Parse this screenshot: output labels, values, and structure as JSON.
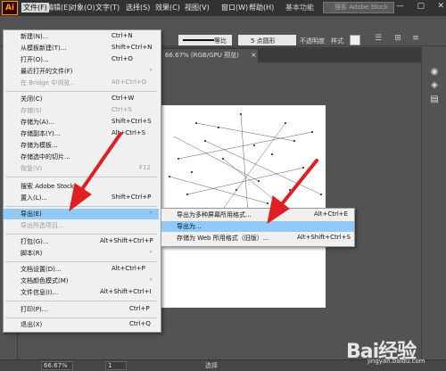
{
  "app": {
    "logo": "Ai",
    "workspace": "基本功能",
    "stock_search_placeholder": "搜索 Adobe Stock"
  },
  "menubar": [
    {
      "label": "文件(F)"
    },
    {
      "label": "编辑(E)"
    },
    {
      "label": "对象(O)"
    },
    {
      "label": "文字(T)"
    },
    {
      "label": "选择(S)"
    },
    {
      "label": "效果(C)"
    },
    {
      "label": "视图(V)"
    },
    {
      "label": "窗口(W)"
    },
    {
      "label": "帮助(H)"
    }
  ],
  "controlbar": {
    "stroke_style": "等比",
    "brush": "5 点圆形",
    "opacity_label": "不透明度",
    "style_label": "样式"
  },
  "document_tab": {
    "title": "66.67% (RGB/GPU 预览)"
  },
  "file_menu": {
    "items": [
      {
        "label": "新建(N)...",
        "shortcut": "Ctrl+N",
        "enabled": true
      },
      {
        "label": "从模板新建(T)...",
        "shortcut": "Shift+Ctrl+N",
        "enabled": true
      },
      {
        "label": "打开(O)...",
        "shortcut": "Ctrl+O",
        "enabled": true
      },
      {
        "label": "最近打开的文件(F)",
        "shortcut": "",
        "enabled": true,
        "submenu": true
      },
      {
        "label": "在 Bridge 中浏览...",
        "shortcut": "Alt+Ctrl+O",
        "enabled": false
      },
      {
        "label": "关闭(C)",
        "shortcut": "Ctrl+W",
        "enabled": true
      },
      {
        "label": "存储(S)",
        "shortcut": "Ctrl+S",
        "enabled": false
      },
      {
        "label": "存储为(A)...",
        "shortcut": "Shift+Ctrl+S",
        "enabled": true
      },
      {
        "label": "存储副本(Y)...",
        "shortcut": "Alt+Ctrl+S",
        "enabled": true
      },
      {
        "label": "存储为模板...",
        "shortcut": "",
        "enabled": true
      },
      {
        "label": "存储选中的切片...",
        "shortcut": "",
        "enabled": true
      },
      {
        "label": "恢复(V)",
        "shortcut": "F12",
        "enabled": false
      },
      {
        "label": "搜索 Adobe Stock...",
        "shortcut": "",
        "enabled": true
      },
      {
        "label": "置入(L)...",
        "shortcut": "Shift+Ctrl+P",
        "enabled": true
      },
      {
        "label": "导出(E)",
        "shortcut": "",
        "enabled": true,
        "submenu": true,
        "highlight": true
      },
      {
        "label": "导出所选项目...",
        "shortcut": "",
        "enabled": false
      },
      {
        "label": "打包(G)...",
        "shortcut": "Alt+Shift+Ctrl+P",
        "enabled": true
      },
      {
        "label": "脚本(R)",
        "shortcut": "",
        "enabled": true,
        "submenu": true
      },
      {
        "label": "文档设置(D)...",
        "shortcut": "Alt+Ctrl+P",
        "enabled": true
      },
      {
        "label": "文档颜色模式(M)",
        "shortcut": "",
        "enabled": true,
        "submenu": true
      },
      {
        "label": "文件信息(I)...",
        "shortcut": "Alt+Shift+Ctrl+I",
        "enabled": true
      },
      {
        "label": "打印(P)...",
        "shortcut": "Ctrl+P",
        "enabled": true
      },
      {
        "label": "退出(X)",
        "shortcut": "Ctrl+Q",
        "enabled": true
      }
    ]
  },
  "export_menu": {
    "items": [
      {
        "label": "导出为多种屏幕所用格式...",
        "shortcut": "Alt+Ctrl+E",
        "highlight": false
      },
      {
        "label": "导出为...",
        "shortcut": "",
        "highlight": true
      },
      {
        "label": "存储为 Web 所用格式（旧版）...",
        "shortcut": "Alt+Shift+Ctrl+S",
        "highlight": false
      }
    ]
  },
  "statusbar": {
    "zoom": "66.67%",
    "artboard": "1",
    "status": "选择"
  },
  "watermark": {
    "brand": "Bai经验",
    "url": "jingyan.baidu.com"
  },
  "colors": {
    "highlight": "#91c9f7",
    "menu_bg": "#f0f0f0",
    "app_bg": "#535353",
    "titlebar": "#323232",
    "arrow": "#e02020"
  }
}
